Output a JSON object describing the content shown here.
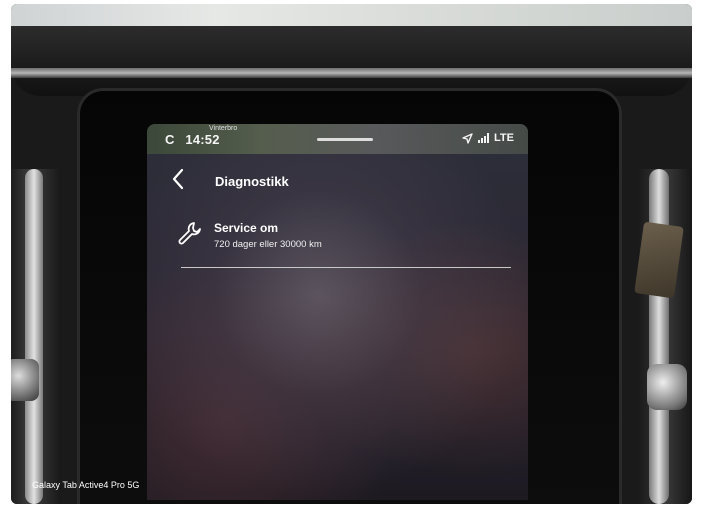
{
  "status_bar": {
    "carrier_letter": "C",
    "time": "14:52",
    "map_place": "Vinterbro",
    "network": "LTE",
    "icons": [
      "navigation-arrow-icon",
      "signal-icon"
    ]
  },
  "header": {
    "back_icon": "chevron-left-icon",
    "title": "Diagnostikk"
  },
  "service": {
    "icon": "wrench-icon",
    "title": "Service om",
    "subtitle": "720 dager eller 30000 km"
  },
  "photo_caption": "Galaxy Tab Active4 Pro 5G"
}
